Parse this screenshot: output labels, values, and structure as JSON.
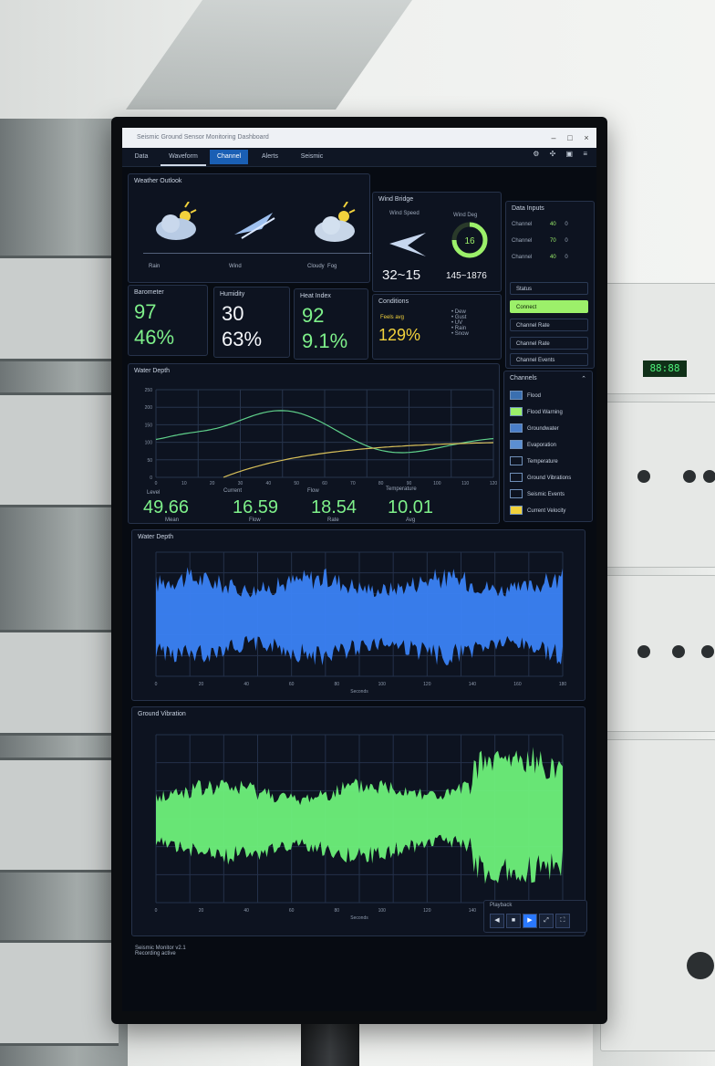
{
  "window": {
    "title": "Seismic Ground Sensor Monitoring Dashboard"
  },
  "tabs": [
    "Data",
    "Waveform",
    "Channel",
    "Alerts",
    "Seismic"
  ],
  "weather": {
    "title": "Weather Outlook",
    "labels": [
      "Rain",
      "Wind",
      "Cloudy",
      "Rain",
      "Fog"
    ]
  },
  "wind": {
    "title": "Wind Bridge",
    "speed_label": "Wind Speed",
    "dir_label": "Wind Deg",
    "speed_value": "32~15",
    "deg_value": "145~1876",
    "gauge_value": "16"
  },
  "stats": [
    {
      "title": "Barometer",
      "v1": "97",
      "v2": "46%"
    },
    {
      "title": "Humidity",
      "v1": "30",
      "v2": "63%"
    },
    {
      "title": "Heat Index",
      "v1": "92",
      "v2": "9.1%"
    }
  ],
  "conditions": {
    "title": "Conditions",
    "sub": "Feels avg",
    "value": "129%",
    "items": [
      "Dew",
      "Gust",
      "UV",
      "Rain",
      "Snow"
    ]
  },
  "side_top": {
    "title": "Data Inputs",
    "rows": [
      {
        "label": "Channel",
        "a": "40",
        "b": "0"
      },
      {
        "label": "Channel",
        "a": "70",
        "b": "0"
      },
      {
        "label": "Channel",
        "a": "40",
        "b": "0"
      }
    ],
    "buttons": [
      "Status",
      "Connect",
      "Channel Rate",
      "Channel Rate",
      "Channel Events"
    ]
  },
  "water": {
    "title": "Water Depth",
    "y_ticks": [
      "250",
      "200",
      "150",
      "100",
      "50",
      "0"
    ],
    "x_ticks": [
      "0",
      "10",
      "20",
      "30",
      "40",
      "50",
      "60",
      "70",
      "80",
      "90",
      "100",
      "110",
      "120"
    ],
    "metrics": [
      {
        "label": "Level",
        "value": "49.66",
        "sub": "Mean"
      },
      {
        "label": "Current",
        "value": "16.59",
        "sub": "Flow"
      },
      {
        "label": "Flow",
        "value": "18.54",
        "sub": "Rate"
      },
      {
        "label": "Temperature",
        "value": "10.01",
        "sub": "Avg"
      }
    ]
  },
  "legend": {
    "title": "Channels",
    "items": [
      {
        "label": "Flood",
        "color": "#3a6fb0"
      },
      {
        "label": "Flood Warning",
        "color": "#9cf06a"
      },
      {
        "label": "Groundwater",
        "color": "#4a7ec8"
      },
      {
        "label": "Evaporation",
        "color": "#5b8fd2"
      },
      {
        "label": "Temperature",
        "color": "#0d1320"
      },
      {
        "label": "Ground Vibrations",
        "color": "#0d1320"
      },
      {
        "label": "Seismic Events",
        "color": "#0d1320"
      },
      {
        "label": "Current Velocity",
        "color": "#f2d23c"
      }
    ]
  },
  "wave1": {
    "title": "Water Depth",
    "x_ticks": [
      "0",
      "20",
      "40",
      "60",
      "80",
      "100",
      "120",
      "140",
      "160",
      "180"
    ],
    "xlabel": "Seconds",
    "fill": "#3b82f6"
  },
  "wave2": {
    "title": "Ground Vibration",
    "x_ticks": [
      "0",
      "20",
      "40",
      "60",
      "80",
      "100",
      "120",
      "140",
      "160",
      "180"
    ],
    "xlabel": "Seconds",
    "fill": "#6ef07a"
  },
  "footer": {
    "line1": "Seismic Monitor v2.1",
    "line2": "Recording active"
  },
  "controls": {
    "label": "Playback",
    "buttons": [
      "◀",
      "■",
      "▶",
      "⤢",
      "⛶"
    ]
  }
}
